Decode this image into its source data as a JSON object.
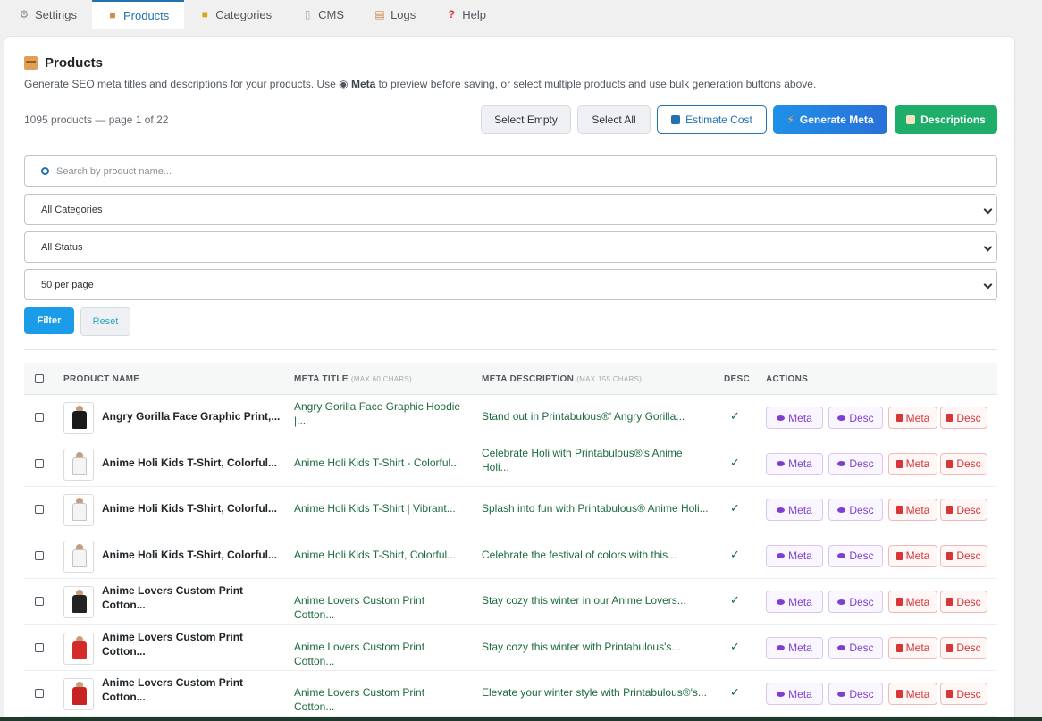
{
  "tabs": [
    {
      "label": "Settings",
      "icon": "gear-icon"
    },
    {
      "label": "Products",
      "icon": "box-icon"
    },
    {
      "label": "Categories",
      "icon": "folder-icon"
    },
    {
      "label": "CMS",
      "icon": "page-icon"
    },
    {
      "label": "Logs",
      "icon": "clipboard-icon"
    },
    {
      "label": "Help",
      "icon": "question-icon"
    }
  ],
  "page": {
    "title": "Products",
    "intro_before": "Generate SEO meta titles and descriptions for your products. Use ",
    "intro_bold": "Meta",
    "intro_after": " to preview before saving, or select multiple products and use bulk generation buttons above.",
    "count": "1095 products — page 1 of 22"
  },
  "toolbar": {
    "select_empty": "Select Empty",
    "select_all": "Select All",
    "estimate_cost": "Estimate Cost",
    "generate_meta": "Generate Meta",
    "descriptions": "Descriptions"
  },
  "filters": {
    "search_placeholder": "Search by product name...",
    "category": "All Categories",
    "status": "All Status",
    "per_page": "50 per page",
    "filter_label": "Filter",
    "reset_label": "Reset"
  },
  "table": {
    "headers": {
      "product": "PRODUCT NAME",
      "meta_title": "META TITLE",
      "meta_title_hint": "(MAX 60 CHARS)",
      "meta_desc": "META DESCRIPTION",
      "meta_desc_hint": "(MAX 155 CHARS)",
      "desc": "DESC",
      "actions": "ACTIONS"
    },
    "action_labels": {
      "meta": "Meta",
      "desc": "Desc",
      "del_meta": "Meta",
      "del_desc": "Desc"
    },
    "rows": [
      {
        "name": "Angry Gorilla Face Graphic Print,...",
        "name2": "",
        "title": "Angry Gorilla Face Graphic Hoodie",
        "title2": "|...",
        "desc": "Stand out in Printabulous®' Angry Gorilla...",
        "desc2": "",
        "check": "✓",
        "shirt": "#1a1a1a"
      },
      {
        "name": "Anime Holi Kids T-Shirt, Colorful...",
        "name2": "",
        "title": "Anime Holi Kids T-Shirt - Colorful...",
        "title2": "",
        "desc": "Celebrate Holi with Printabulous®'s Anime",
        "desc2": "Holi...",
        "check": "✓",
        "shirt": "#f4f4f4"
      },
      {
        "name": "Anime Holi Kids T-Shirt, Colorful...",
        "name2": "",
        "title": "Anime Holi Kids T-Shirt | Vibrant...",
        "title2": "",
        "desc": "Splash into fun with Printabulous® Anime Holi...",
        "desc2": "",
        "check": "✓",
        "shirt": "#f4f4f4"
      },
      {
        "name": "Anime Holi Kids T-Shirt, Colorful...",
        "name2": "",
        "title": "Anime Holi Kids T-Shirt, Colorful...",
        "title2": "",
        "desc": "Celebrate the festival of colors with this...",
        "desc2": "",
        "check": "✓",
        "shirt": "#f4f4f4"
      },
      {
        "name": "Anime Lovers Custom Print",
        "name2": "Cotton...",
        "title": "Anime Lovers Custom Print Cotton...",
        "title2": "",
        "desc": "Stay cozy this winter in our Anime Lovers...",
        "desc2": "",
        "check": "✓",
        "shirt": "#222222"
      },
      {
        "name": "Anime Lovers Custom Print",
        "name2": "Cotton...",
        "title": "Anime Lovers Custom Print Cotton...",
        "title2": "",
        "desc": "Stay cozy this winter with Printabulous's...",
        "desc2": "",
        "check": "✓",
        "shirt": "#d42a2a"
      },
      {
        "name": "Anime Lovers Custom Print",
        "name2": "Cotton...",
        "title": "Anime Lovers Custom Print Cotton...",
        "title2": "",
        "desc": "Elevate your winter style with Printabulous®'s...",
        "desc2": "",
        "check": "✓",
        "shirt": "#c82222"
      }
    ]
  },
  "colors": {
    "accent": "#2271b1",
    "green": "#1fae6a",
    "purple": "#7e3fd1",
    "red": "#d63638"
  }
}
